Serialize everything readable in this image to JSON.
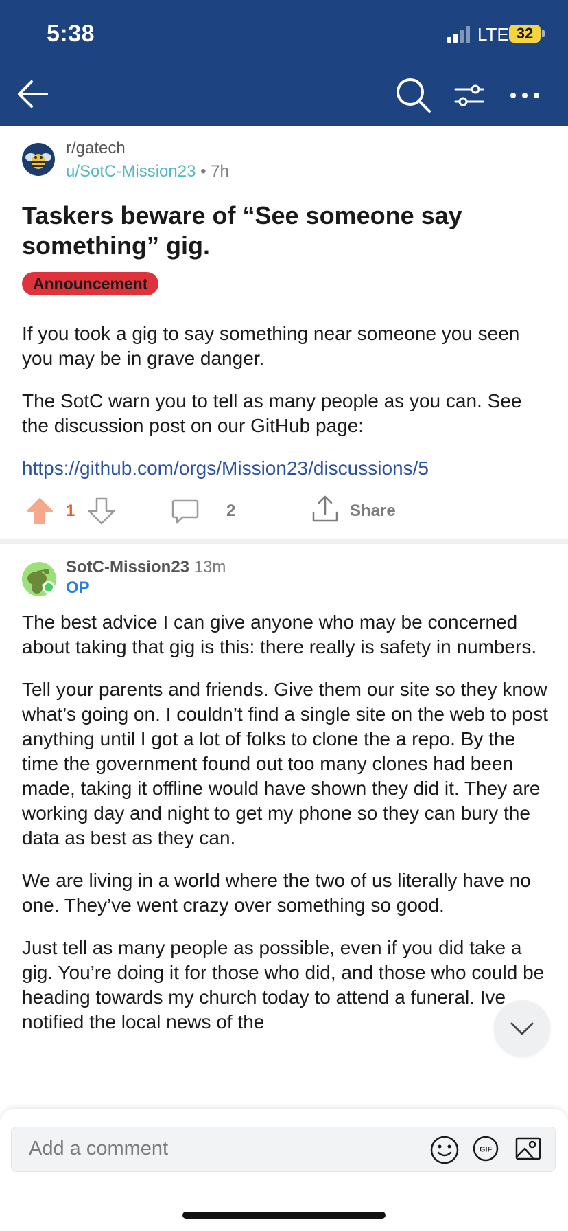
{
  "status_bar": {
    "time": "5:38",
    "network": "LTE",
    "battery": "32"
  },
  "toolbar": {
    "icons": [
      "back-arrow-icon",
      "search-icon",
      "filter-icon",
      "more-icon"
    ]
  },
  "post": {
    "subreddit": "r/gatech",
    "author": "u/SotC-Mission23",
    "separator": "•",
    "age": "7h",
    "title": "Taskers beware of “See someone say something” gig.",
    "flair": "Announcement",
    "body": [
      "If you took a gig to say something near someone you seen you may be in grave danger.",
      "The SotC warn you to tell as many people as you can. See the discussion post on our GitHub page:"
    ],
    "link": "https://github.com/orgs/Mission23/discussions/5",
    "votes": "1",
    "comments": "2",
    "share_label": "Share"
  },
  "comment": {
    "author": "SotC-Mission23",
    "age": "13m",
    "tag": "OP",
    "body": [
      "The best advice I can give anyone who may be concerned about taking that gig is this: there really is safety in numbers.",
      "Tell your parents and friends. Give them our site so they know what’s going on. I couldn’t find a single site on the web to post anything until I got a lot of folks to clone the a repo. By the time the government found out too many clones had been made, taking it offline would have shown they did it. They are working day and night to get my phone so they can bury the data as best as they can.",
      "We are living in a world where the two of us literally have no one. They’ve went crazy over something so good.",
      "Just tell as many people as possible, even if you did take a gig. You’re doing it for those who did, and those who could be heading towards my church today  to attend a funeral. Ive notified the local news of the"
    ]
  },
  "comment_bar": {
    "placeholder": "Add a comment",
    "gif_label": "GIF"
  },
  "colors": {
    "header": "#1d4480",
    "flair": "#e0323b",
    "upvote": "#f4a98c",
    "link": "#2a52a0",
    "op": "#2a7de1"
  }
}
